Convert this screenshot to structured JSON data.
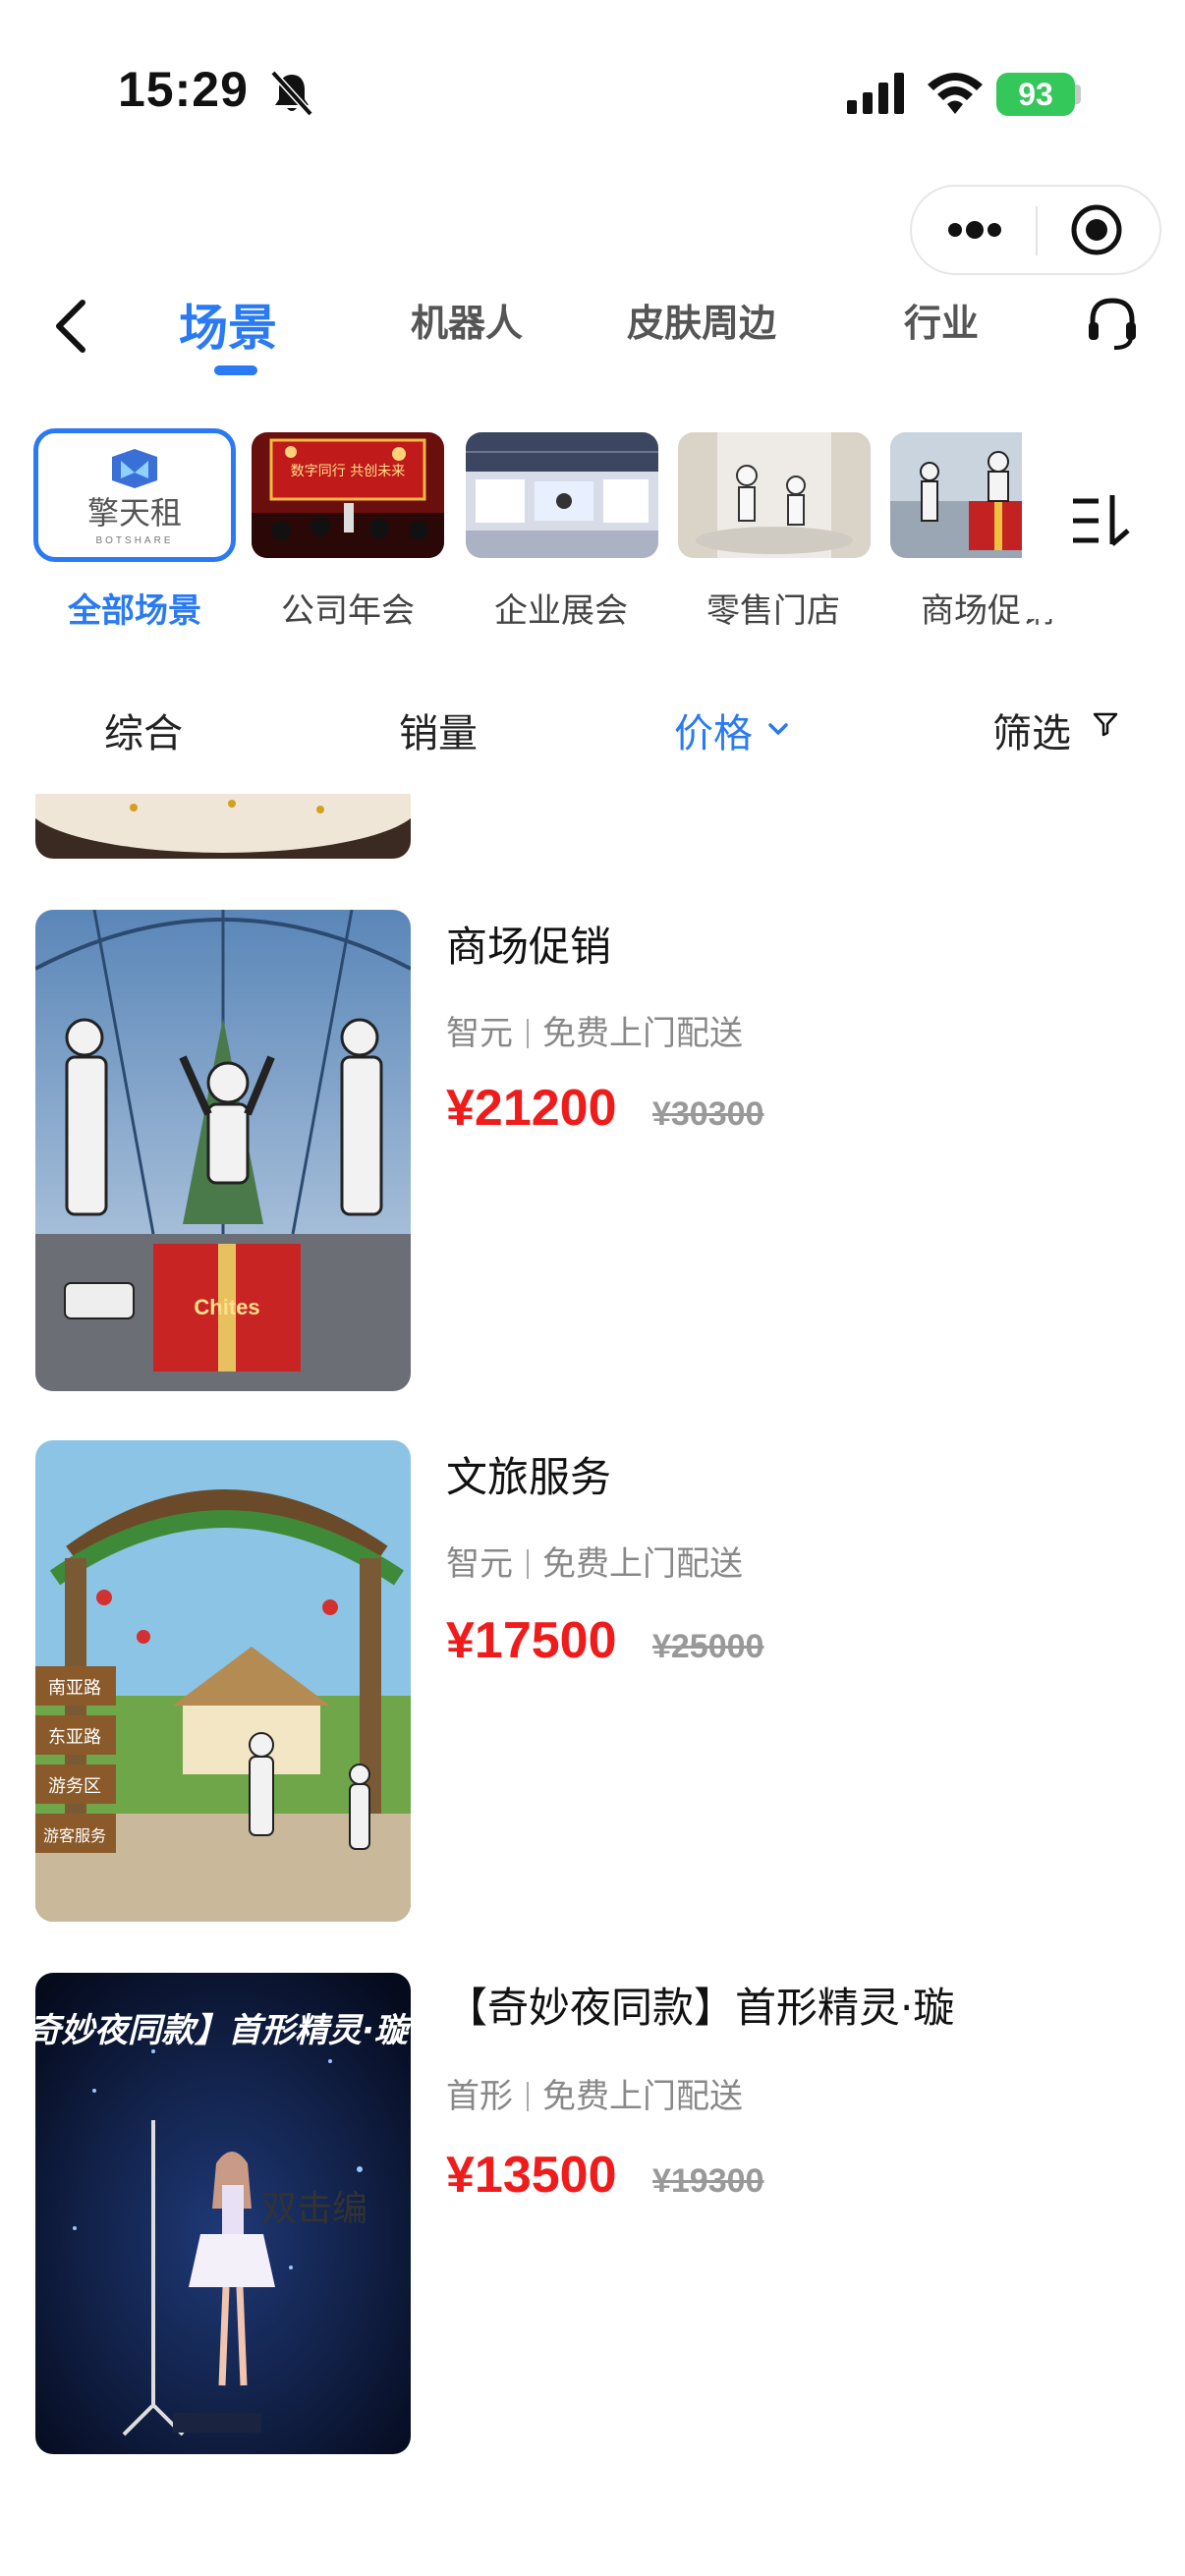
{
  "status_bar": {
    "time": "15:29",
    "battery": "93"
  },
  "nav": {
    "tabs": [
      "场景",
      "机器人",
      "皮肤周边",
      "行业"
    ]
  },
  "categories": [
    {
      "label": "全部场景",
      "logo_text": "擎天租",
      "logo_sub": "BOTSHARE"
    },
    {
      "label": "公司年会",
      "banner_text": "数字同行 共创未来"
    },
    {
      "label": "企业展会"
    },
    {
      "label": "零售门店"
    },
    {
      "label": "商场促销"
    }
  ],
  "sort": {
    "comprehensive": "综合",
    "sales": "销量",
    "price": "价格",
    "filter": "筛选"
  },
  "products": [
    {
      "title": "商场促销",
      "brand": "智元",
      "delivery": "免费上门配送",
      "price": "¥21200",
      "original_price": "¥30300",
      "image_text": "Chites"
    },
    {
      "title": "文旅服务",
      "brand": "智元",
      "delivery": "免费上门配送",
      "price": "¥17500",
      "original_price": "¥25000",
      "signs": [
        "南亚路",
        "东亚路",
        "游务区",
        "游客服务"
      ]
    },
    {
      "title": "【奇妙夜同款】首形精灵·璇",
      "brand": "首形",
      "delivery": "免费上门配送",
      "price": "¥13500",
      "original_price": "¥19300",
      "image_text": "奇妙夜同款】首形精灵·璇",
      "overlay_text": "双击编"
    }
  ],
  "colors": {
    "accent": "#2a7af3",
    "price": "#f01c1c",
    "battery": "#34c759"
  }
}
